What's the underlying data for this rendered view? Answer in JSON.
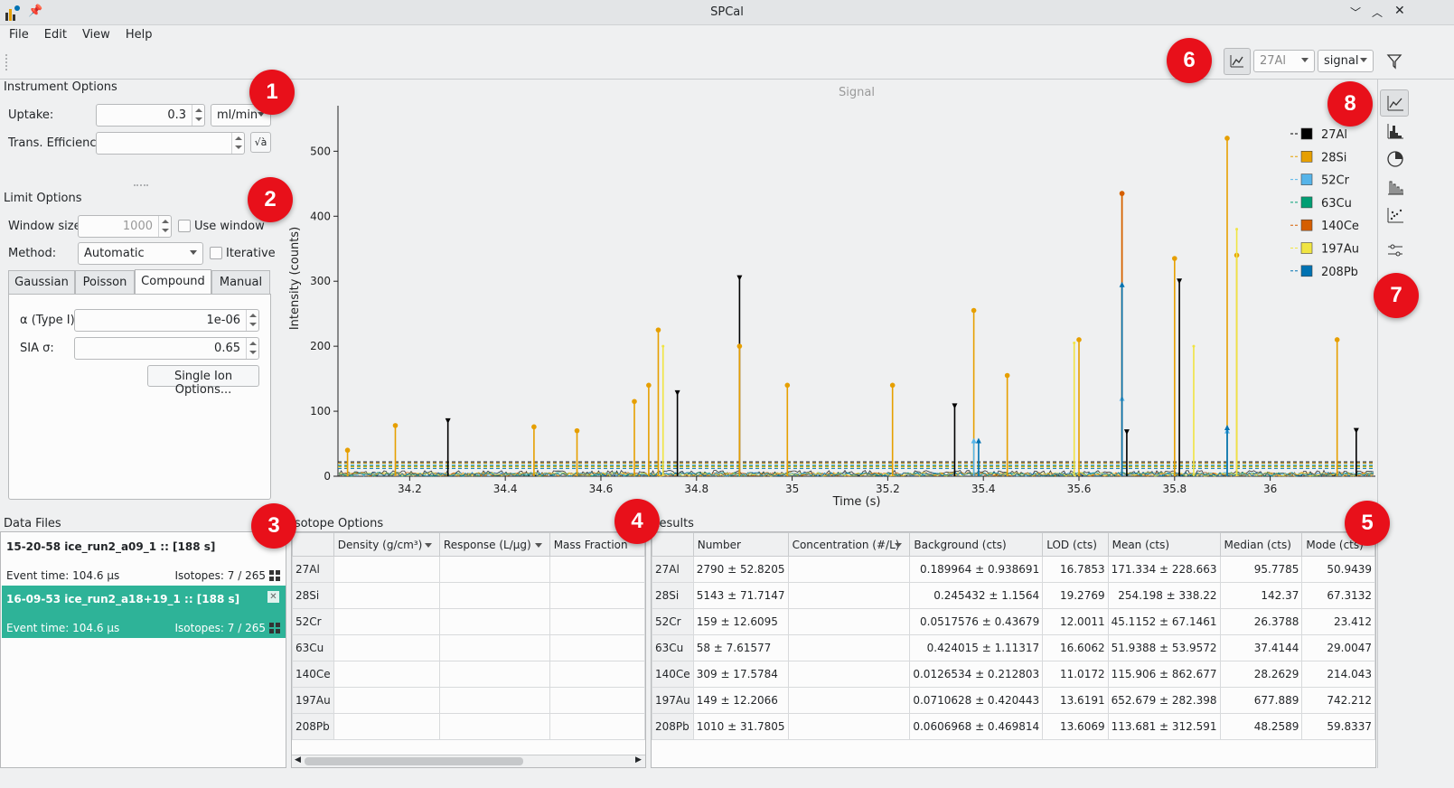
{
  "window": {
    "title": "SPCal"
  },
  "menu": [
    "File",
    "Edit",
    "View",
    "Help"
  ],
  "toolbar": {
    "isotope_select": "27Al",
    "mode_select": "signal"
  },
  "instrument": {
    "title": "Instrument Options",
    "uptake_label": "Uptake:",
    "uptake_value": "0.3",
    "uptake_unit": "ml/min",
    "trans_label": "Trans. Efficiency:",
    "trans_value": "",
    "trans_btn": "√à"
  },
  "limit": {
    "title": "Limit Options",
    "window_label": "Window size:",
    "window_value": "1000",
    "use_window": "Use window",
    "method_label": "Method:",
    "method_value": "Automatic",
    "iterative": "Iterative",
    "tabs": [
      "Gaussian",
      "Poisson",
      "Compound",
      "Manual"
    ],
    "alpha_label": "α (Type I):",
    "alpha_value": "1e-06",
    "sia_label": "SIA σ:",
    "sia_value": "0.65",
    "single_ion_btn": "Single Ion Options..."
  },
  "data_files": {
    "title": "Data Files",
    "items": [
      {
        "name": "15-20-58 ice_run2_a09_1 :: [188 s]",
        "event": "Event time: 104.6 µs",
        "isotopes": "Isotopes: 7 / 265"
      },
      {
        "name": "16-09-53 ice_run2_a18+19_1 :: [188 s]",
        "event": "Event time: 104.6 µs",
        "isotopes": "Isotopes: 7 / 265"
      }
    ]
  },
  "isotope_options": {
    "title": "Isotope Options",
    "headers": [
      "Density (g/cm³)",
      "Response (L/µg)",
      "Mass Fraction"
    ],
    "rows": [
      "27Al",
      "28Si",
      "52Cr",
      "63Cu",
      "140Ce",
      "197Au",
      "208Pb"
    ]
  },
  "results": {
    "title": "Results",
    "headers": [
      "Number",
      "Concentration (#/L)",
      "Background (cts)",
      "LOD (cts)",
      "Mean (cts)",
      "Median (cts)",
      "Mode (cts)"
    ],
    "rows": [
      {
        "iso": "27Al",
        "number": "2790 ± 52.8205",
        "conc": "",
        "bg": "0.189964 ± 0.938691",
        "lod": "16.7853",
        "mean": "171.334 ± 228.663",
        "median": "95.7785",
        "mode": "50.9439"
      },
      {
        "iso": "28Si",
        "number": "5143 ± 71.7147",
        "conc": "",
        "bg": "0.245432 ± 1.1564",
        "lod": "19.2769",
        "mean": "254.198 ± 338.22",
        "median": "142.37",
        "mode": "67.3132"
      },
      {
        "iso": "52Cr",
        "number": "159 ± 12.6095",
        "conc": "",
        "bg": "0.0517576 ± 0.43679",
        "lod": "12.0011",
        "mean": "45.1152 ± 67.1461",
        "median": "26.3788",
        "mode": "23.412"
      },
      {
        "iso": "63Cu",
        "number": "58 ± 7.61577",
        "conc": "",
        "bg": "0.424015 ± 1.11317",
        "lod": "16.6062",
        "mean": "51.9388 ± 53.9572",
        "median": "37.4144",
        "mode": "29.0047"
      },
      {
        "iso": "140Ce",
        "number": "309 ± 17.5784",
        "conc": "",
        "bg": "0.0126534 ± 0.212803",
        "lod": "11.0172",
        "mean": "115.906 ± 862.677",
        "median": "28.2629",
        "mode": "214.043"
      },
      {
        "iso": "197Au",
        "number": "149 ± 12.2066",
        "conc": "",
        "bg": "0.0710628 ± 0.420443",
        "lod": "13.6191",
        "mean": "652.679 ± 282.398",
        "median": "677.889",
        "mode": "742.212"
      },
      {
        "iso": "208Pb",
        "number": "1010 ± 31.7805",
        "conc": "",
        "bg": "0.0606968 ± 0.469814",
        "lod": "13.6069",
        "mean": "113.681 ± 312.591",
        "median": "48.2589",
        "mode": "59.8337"
      }
    ]
  },
  "badges": [
    "1",
    "2",
    "3",
    "4",
    "5",
    "6",
    "7",
    "8"
  ],
  "colors": {
    "accent": "#2eb398",
    "badge": "#e8101a"
  },
  "chart_data": {
    "type": "line",
    "title": "Signal",
    "xlabel": "Time (s)",
    "ylabel": "Intensity (counts)",
    "xlim": [
      34.05,
      36.22
    ],
    "ylim": [
      0,
      570
    ],
    "xticks": [
      34.2,
      34.4,
      34.6,
      34.8,
      35.0,
      35.2,
      35.4,
      35.6,
      35.8,
      36.0
    ],
    "yticks": [
      0,
      100,
      200,
      300,
      400,
      500
    ],
    "legend_position": "top-right",
    "series": [
      {
        "name": "27Al",
        "color": "#000000",
        "baseline": 22,
        "peaks": [
          [
            34.28,
            85
          ],
          [
            34.76,
            128
          ],
          [
            34.89,
            305
          ],
          [
            35.34,
            108
          ],
          [
            35.7,
            68
          ],
          [
            35.81,
            300
          ],
          [
            36.18,
            70
          ]
        ]
      },
      {
        "name": "28Si",
        "color": "#e69f00",
        "baseline": 20,
        "peaks": [
          [
            34.07,
            40
          ],
          [
            34.17,
            78
          ],
          [
            34.46,
            76
          ],
          [
            34.55,
            70
          ],
          [
            34.67,
            115
          ],
          [
            34.7,
            140
          ],
          [
            34.72,
            225
          ],
          [
            34.89,
            200
          ],
          [
            34.99,
            140
          ],
          [
            35.21,
            140
          ],
          [
            35.38,
            255
          ],
          [
            35.45,
            155
          ],
          [
            35.6,
            210
          ],
          [
            35.69,
            435
          ],
          [
            35.8,
            335
          ],
          [
            35.91,
            520
          ],
          [
            35.93,
            340
          ],
          [
            36.14,
            210
          ]
        ]
      },
      {
        "name": "52Cr",
        "color": "#56b4e9",
        "baseline": 18,
        "peaks": [
          [
            35.38,
            55
          ],
          [
            35.69,
            120
          ],
          [
            35.91,
            70
          ]
        ]
      },
      {
        "name": "63Cu",
        "color": "#009e73",
        "baseline": 16,
        "peaks": []
      },
      {
        "name": "140Ce",
        "color": "#d55e00",
        "baseline": 15,
        "peaks": [
          [
            35.69,
            435
          ]
        ]
      },
      {
        "name": "197Au",
        "color": "#f0e442",
        "baseline": 14,
        "peaks": [
          [
            34.73,
            200
          ],
          [
            35.59,
            205
          ],
          [
            35.84,
            200
          ],
          [
            35.93,
            380
          ]
        ]
      },
      {
        "name": "208Pb",
        "color": "#0072b2",
        "baseline": 12,
        "peaks": [
          [
            35.69,
            295
          ],
          [
            35.91,
            75
          ],
          [
            35.39,
            55
          ]
        ]
      }
    ]
  }
}
